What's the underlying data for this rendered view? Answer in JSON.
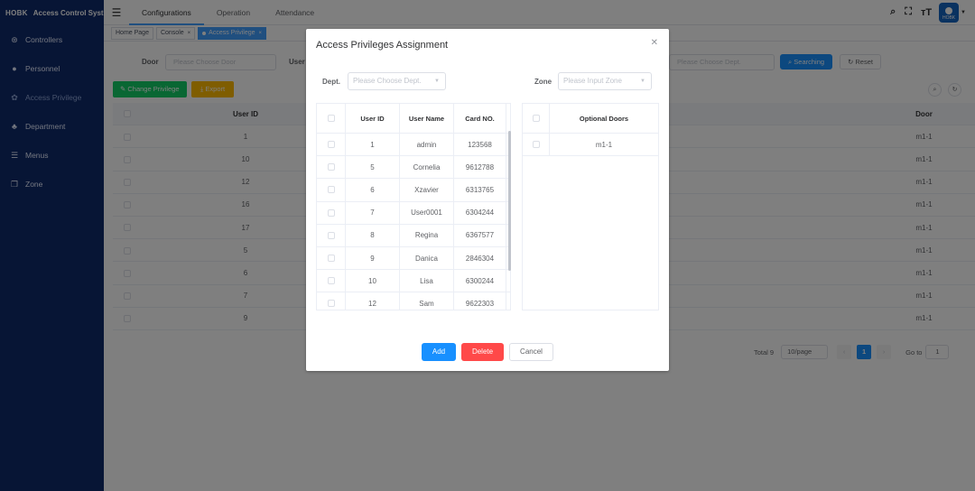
{
  "brand": {
    "logo": "HOBK",
    "title": "Access Control System"
  },
  "sidebar": {
    "items": [
      {
        "label": "Controllers",
        "icon": "tag-icon",
        "glyph": "⊛"
      },
      {
        "label": "Personnel",
        "icon": "person-icon",
        "glyph": "●"
      },
      {
        "label": "Access Privilege",
        "icon": "gear-icon",
        "glyph": "✿",
        "active": true
      },
      {
        "label": "Department",
        "icon": "tree-icon",
        "glyph": "♣"
      },
      {
        "label": "Menus",
        "icon": "list-icon",
        "glyph": "☰"
      },
      {
        "label": "Zone",
        "icon": "copy-icon",
        "glyph": "❐"
      }
    ]
  },
  "topbar": {
    "tabs": [
      "Configurations",
      "Operation",
      "Attendance"
    ],
    "avatar_text": "HOBK"
  },
  "tags": [
    {
      "label": "Home Page"
    },
    {
      "label": "Console"
    },
    {
      "label": "Access Privilege"
    }
  ],
  "filters": {
    "door_label": "Door",
    "door_placeholder": "Please Choose Door",
    "user_label": "User",
    "dept_placeholder": "Please Choose Dept.",
    "search_label": "Searching",
    "reset_label": "Reset"
  },
  "actions": {
    "change_label": "Change Privilege",
    "export_label": "Export"
  },
  "bg_table": {
    "headers": {
      "user_id": "User ID",
      "door": "Door"
    },
    "rows": [
      {
        "user_id": "1",
        "door": "m1-1"
      },
      {
        "user_id": "10",
        "door": "m1-1"
      },
      {
        "user_id": "12",
        "door": "m1-1"
      },
      {
        "user_id": "16",
        "door": "m1-1"
      },
      {
        "user_id": "17",
        "door": "m1-1"
      },
      {
        "user_id": "5",
        "door": "m1-1"
      },
      {
        "user_id": "6",
        "door": "m1-1"
      },
      {
        "user_id": "7",
        "door": "m1-1"
      },
      {
        "user_id": "9",
        "door": "m1-1"
      }
    ]
  },
  "pagination": {
    "total": "Total 9",
    "page_size": "10/page",
    "current": "1",
    "goto": "Go to",
    "goto_value": "1"
  },
  "dialog": {
    "title": "Access Privileges Assignment",
    "dept_label": "Dept.",
    "dept_placeholder": "Please Choose Dept.",
    "zone_label": "Zone",
    "zone_placeholder": "Please Input Zone",
    "user_table": {
      "headers": {
        "user_id": "User ID",
        "user_name": "User Name",
        "card_no": "Card NO."
      },
      "rows": [
        {
          "user_id": "1",
          "user_name": "admin",
          "card_no": "123568"
        },
        {
          "user_id": "5",
          "user_name": "Cornelia",
          "card_no": "9612788"
        },
        {
          "user_id": "6",
          "user_name": "Xzavier",
          "card_no": "6313765"
        },
        {
          "user_id": "7",
          "user_name": "User0001",
          "card_no": "6304244"
        },
        {
          "user_id": "8",
          "user_name": "Regina",
          "card_no": "6367577"
        },
        {
          "user_id": "9",
          "user_name": "Danica",
          "card_no": "2846304"
        },
        {
          "user_id": "10",
          "user_name": "Lisa",
          "card_no": "6300244"
        },
        {
          "user_id": "12",
          "user_name": "Sam",
          "card_no": "9622303"
        }
      ]
    },
    "door_table": {
      "header": "Optional Doors",
      "rows": [
        {
          "door": "m1-1"
        }
      ]
    },
    "buttons": {
      "add": "Add",
      "delete": "Delete",
      "cancel": "Cancel"
    }
  },
  "colors": {
    "sidebar": "#0e2a6b",
    "primary": "#1890ff",
    "danger": "#ff4949",
    "success": "#13ce66",
    "warning": "#ffba00"
  }
}
